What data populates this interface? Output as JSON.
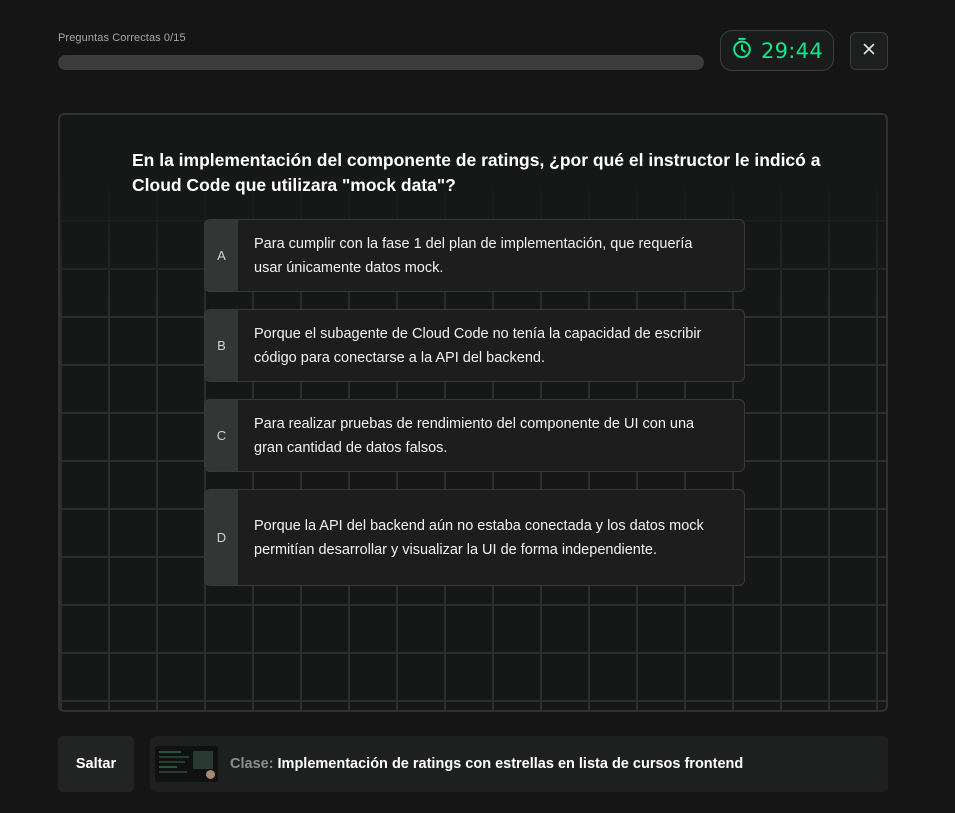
{
  "progress": {
    "label": "Preguntas Correctas 0/15",
    "fraction": 0
  },
  "timer": {
    "icon": "stopwatch-icon",
    "value": "29:44",
    "color": "#12e58b"
  },
  "close": {
    "icon": "close-icon"
  },
  "question": {
    "text": "En la implementación del componente de ratings, ¿por qué el instructor le indicó a Cloud Code que utilizara \"mock data\"?"
  },
  "options": [
    {
      "letter": "A",
      "text": "Para cumplir con la fase 1 del plan de implementación, que requería usar únicamente datos mock."
    },
    {
      "letter": "B",
      "text": "Porque el subagente de Cloud Code no tenía la capacidad de escribir código para conectarse a la API del backend."
    },
    {
      "letter": "C",
      "text": "Para realizar pruebas de rendimiento del componente de UI con una gran cantidad de datos falsos."
    },
    {
      "letter": "D",
      "text": "Porque la API del backend aún no estaba conectada y los datos mock permitían desarrollar y visualizar la UI de forma independiente."
    }
  ],
  "footer": {
    "skip_label": "Saltar",
    "class_label": "Clase:",
    "class_title": "Implementación de ratings con estrellas en lista de cursos frontend"
  }
}
